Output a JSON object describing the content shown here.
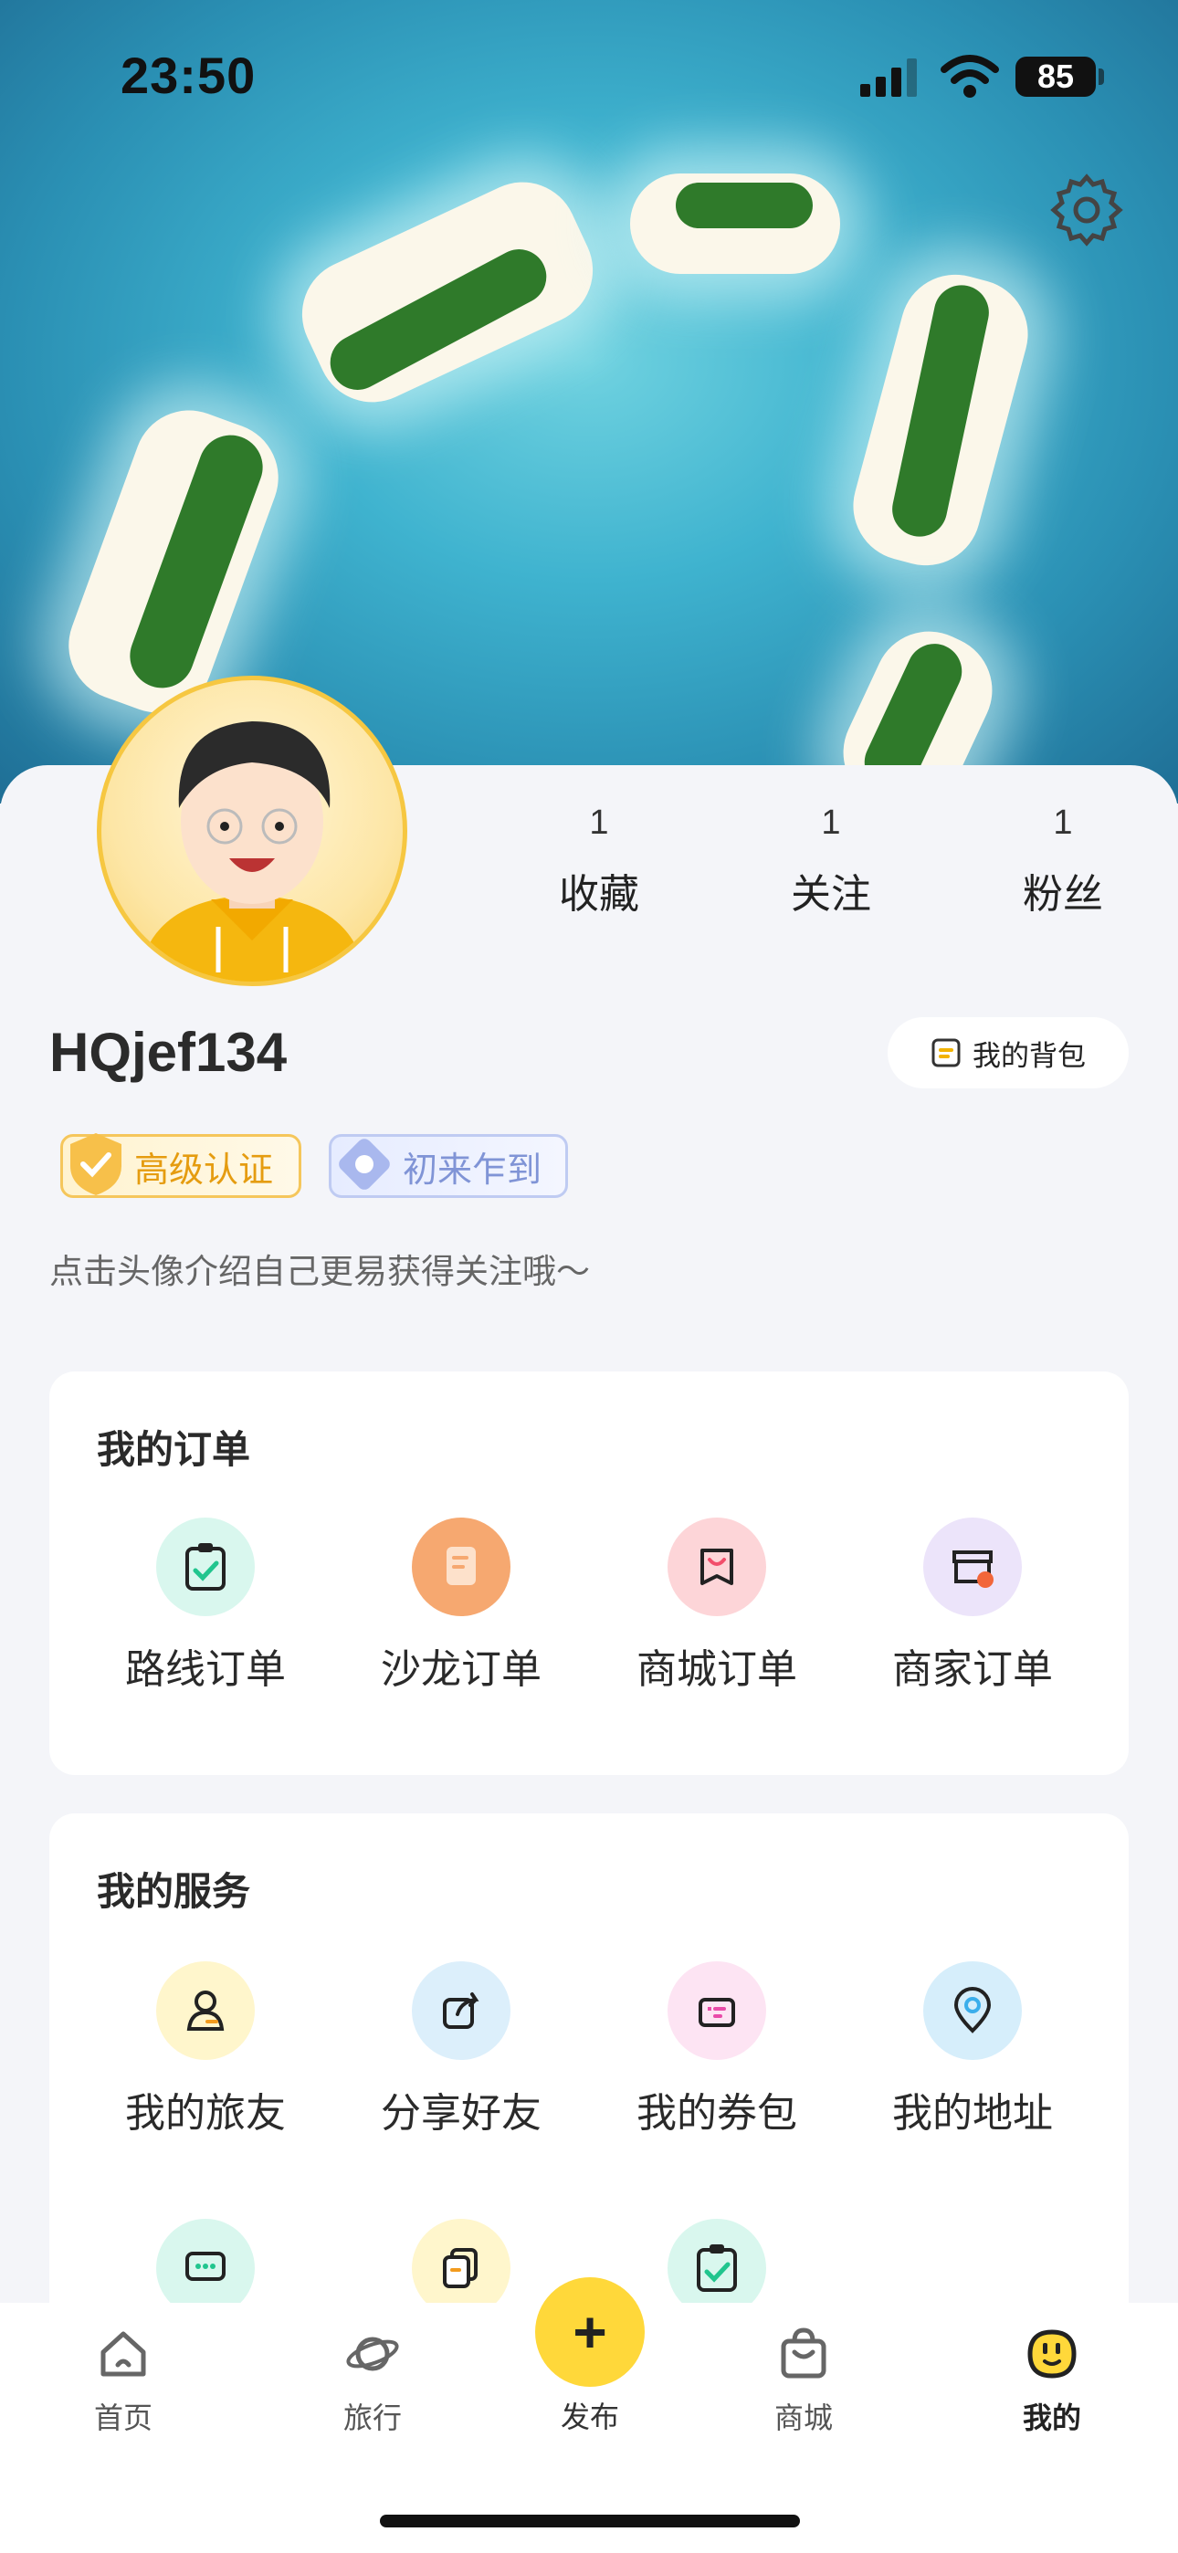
{
  "status": {
    "time": "23:50",
    "battery": "85"
  },
  "profile": {
    "stats": [
      {
        "num": "1",
        "label": "收藏"
      },
      {
        "num": "1",
        "label": "关注"
      },
      {
        "num": "1",
        "label": "粉丝"
      }
    ],
    "username": "HQjef134",
    "bag_label": "我的背包",
    "badges": [
      {
        "label": "高级认证"
      },
      {
        "label": "初来乍到"
      }
    ],
    "bio": "点击头像介绍自己更易获得关注哦～"
  },
  "orders": {
    "title": "我的订单",
    "items": [
      {
        "label": "路线订单",
        "icon": "clipboard-check-icon",
        "color": "#D9F7EE"
      },
      {
        "label": "沙龙订单",
        "icon": "document-icon",
        "color": "#F6A870"
      },
      {
        "label": "商城订单",
        "icon": "shopping-bag-icon",
        "color": "#FDD5D8"
      },
      {
        "label": "商家订单",
        "icon": "store-icon",
        "color": "#ECE4FA"
      }
    ]
  },
  "services": {
    "title": "我的服务",
    "items": [
      {
        "label": "我的旅友",
        "icon": "person-icon",
        "color": "#FFF6CC"
      },
      {
        "label": "分享好友",
        "icon": "share-icon",
        "color": "#DCEFFB"
      },
      {
        "label": "我的券包",
        "icon": "coupon-wallet-icon",
        "color": "#FDE4F3"
      },
      {
        "label": "我的地址",
        "icon": "location-pin-icon",
        "color": "#D6EEFB"
      },
      {
        "label": "",
        "icon": "chat-icon",
        "color": "#D9F7EE"
      },
      {
        "label": "",
        "icon": "copy-document-icon",
        "color": "#FFF6CC"
      },
      {
        "label": "",
        "icon": "clipboard-check-icon",
        "color": "#D9F7EE"
      }
    ]
  },
  "tabbar": {
    "tabs": [
      {
        "label": "首页",
        "icon": "home-icon"
      },
      {
        "label": "旅行",
        "icon": "planet-icon"
      },
      {
        "label": "商城",
        "icon": "bag-icon"
      },
      {
        "label": "我的",
        "icon": "face-icon"
      }
    ],
    "publish_label": "发布",
    "publish_symbol": "+"
  }
}
